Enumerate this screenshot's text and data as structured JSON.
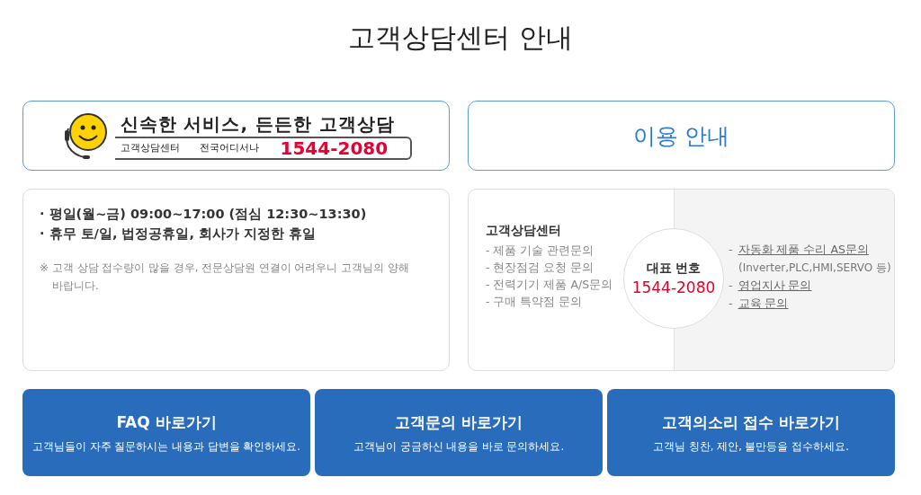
{
  "title": "고객상담센터 안내",
  "banner": {
    "headline": "신속한 서비스, 든든한 고객상담",
    "label": "고객상담센터",
    "slogan": "전국어디서나",
    "phone": "1544-2080"
  },
  "usage_header": "이용 안내",
  "hours_card": {
    "lines": [
      "· 평일(월~금) 09:00~17:00 (점심 12:30~13:30)",
      "· 휴무 토/일, 법정공휴일, 회사가 지정한 휴일"
    ],
    "note_mark": "※",
    "note": "고객 상담 접수량이 많을 경우, 전문상담원 연결이 어려우니 고객님의 양해 바랍니다."
  },
  "center_card": {
    "title": "고객상담센터",
    "items": [
      "- 제품 기술 관련문의",
      "- 현장점검 요청 문의",
      "- 전력기기 제품 A/S문의",
      "- 구매 특약점 문의"
    ],
    "circle_label": "대표 번호",
    "circle_phone": "1544-2080",
    "links": [
      {
        "kind": "link",
        "bullet": "-",
        "text": "자동화 제품 수리 AS문의"
      },
      {
        "kind": "note",
        "text": "(Inverter,PLC,HMI,SERVO 등)"
      },
      {
        "kind": "link",
        "bullet": "-",
        "text": "영업지사 문의"
      },
      {
        "kind": "link",
        "bullet": "-",
        "text": "교육 문의"
      }
    ]
  },
  "shortcuts": [
    {
      "title": "FAQ 바로가기",
      "desc": "고객님들이 자주 질문하시는 내용과 답변을 확인하세요."
    },
    {
      "title": "고객문의 바로가기",
      "desc": "고객님이 궁금하신 내용을 바로 문의하세요."
    },
    {
      "title": "고객의소리 접수 바로가기",
      "desc": "고객님 칭찬, 제안, 불만등을 접수하세요."
    }
  ]
}
